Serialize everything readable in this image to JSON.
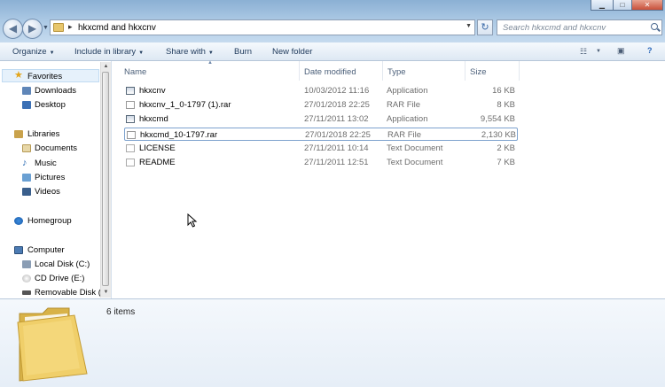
{
  "window": {
    "minimize": "▁",
    "maximize": "□",
    "close": "✕"
  },
  "nav": {
    "back": "◀",
    "forward": "▶",
    "recent": "▼"
  },
  "address": {
    "separator": "▸",
    "path": "hkxcmd and hkxcnv",
    "dropdown": "▼",
    "refresh": "↻"
  },
  "search": {
    "placeholder": "Search hkxcmd and hkxcnv"
  },
  "toolbar": {
    "organize": "Organize",
    "include_in_library": "Include in library",
    "share_with": "Share with",
    "burn": "Burn",
    "new_folder": "New folder",
    "arrow": "▼"
  },
  "sidebar": {
    "favorites": "Favorites",
    "downloads": "Downloads",
    "desktop": "Desktop",
    "libraries": "Libraries",
    "documents": "Documents",
    "music": "Music",
    "pictures": "Pictures",
    "videos": "Videos",
    "homegroup": "Homegroup",
    "computer": "Computer",
    "local_disk": "Local Disk (C:)",
    "cd_drive": "CD Drive (E:)",
    "removable_disk": "Removable Disk ("
  },
  "columns": {
    "name": "Name",
    "date": "Date modified",
    "type": "Type",
    "size": "Size",
    "sort_indicator": "▲"
  },
  "files": [
    {
      "name": "hkxcnv",
      "date": "10/03/2012 11:16",
      "type": "Application",
      "size": "16 KB"
    },
    {
      "name": "hkxcnv_1_0-1797 (1).rar",
      "date": "27/01/2018 22:25",
      "type": "RAR File",
      "size": "8 KB"
    },
    {
      "name": "hkxcmd",
      "date": "27/11/2011 13:02",
      "type": "Application",
      "size": "9,554 KB"
    },
    {
      "name": "hkxcmd_10-1797.rar",
      "date": "27/01/2018 22:25",
      "type": "RAR File",
      "size": "2,130 KB"
    },
    {
      "name": "LICENSE",
      "date": "27/11/2011 10:14",
      "type": "Text Document",
      "size": "2 KB"
    },
    {
      "name": "README",
      "date": "27/11/2011 12:51",
      "type": "Text Document",
      "size": "7 KB"
    }
  ],
  "status": {
    "item_count": "6 items"
  },
  "colors": {
    "accent": "#1e395b",
    "selection_border": "#7da2ce"
  }
}
